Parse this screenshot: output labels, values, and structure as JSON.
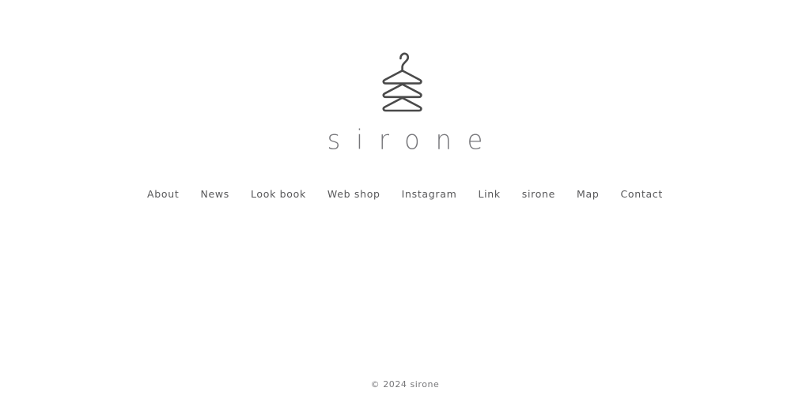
{
  "site": {
    "background_color": "#ffffff",
    "brand_name": "sirone",
    "logo_icon": "clothes-hanger-stack-icon",
    "logo_color": "#4a4a4a",
    "wordmark_color": "#76767a",
    "wordmark_text": "sirone"
  },
  "nav": {
    "items": [
      {
        "label": "About"
      },
      {
        "label": "News"
      },
      {
        "label": "Look book"
      },
      {
        "label": "Web shop"
      },
      {
        "label": "Instagram"
      },
      {
        "label": "Link"
      },
      {
        "label": "sirone"
      },
      {
        "label": "Map"
      },
      {
        "label": "Contact"
      }
    ],
    "text_color": "#58585a"
  },
  "footer": {
    "copyright": "© 2024 sirone",
    "text_color": "#767679"
  }
}
